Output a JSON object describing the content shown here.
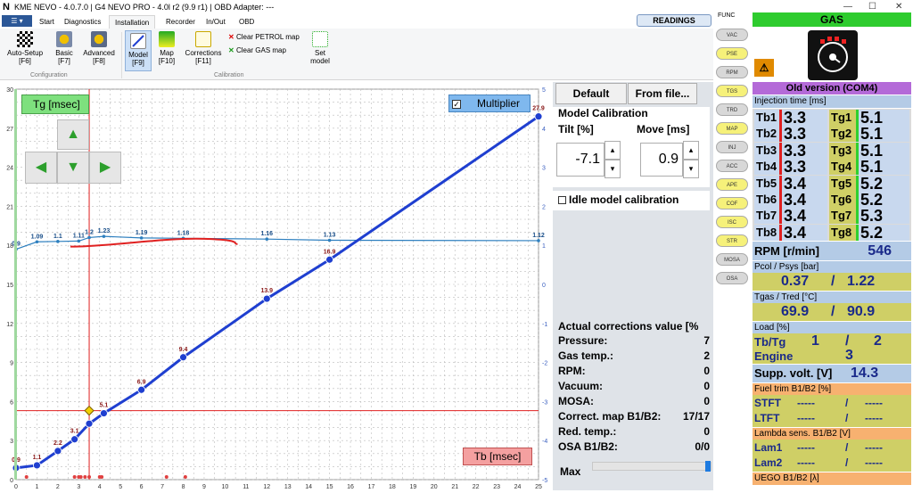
{
  "window": {
    "title": "KME NEVO - 4.0.7.0  |  G4 NEVO PRO - 4.0l r2 (9.9 r1)  |  OBD Adapter: ---",
    "logo": "N"
  },
  "menu": {
    "file": "☰ ▾",
    "tabs": [
      "Start",
      "Diagnostics",
      "Installation",
      "Recorder",
      "In/Out",
      "OBD"
    ],
    "readings": "READINGS"
  },
  "ribbon": {
    "buttons": [
      {
        "label": "Auto-Setup",
        "key": "[F6]"
      },
      {
        "label": "Basic",
        "key": "[F7]"
      },
      {
        "label": "Advanced",
        "key": "[F8]"
      },
      {
        "label": "Model",
        "key": "[F9]"
      },
      {
        "label": "Map",
        "key": "[F10]"
      },
      {
        "label": "Corrections",
        "key": "[F11]"
      }
    ],
    "clear_petrol": "Clear PETROL map",
    "clear_gas": "Clear GAS map",
    "set_model": "Set model",
    "group_config": "Configuration",
    "group_calib": "Calibration"
  },
  "chart": {
    "tg_label": "Tg [msec]",
    "tb_label": "Tb [msec]",
    "multiplier": "Multiplier",
    "left_ticks": [
      "30",
      "27",
      "24",
      "21",
      "18",
      "15",
      "12",
      "9",
      "6",
      "3",
      "0"
    ],
    "right_ticks": [
      "5",
      "4",
      "3",
      "2",
      "1",
      "0",
      "-1",
      "-2",
      "-3",
      "-4",
      "-5"
    ],
    "x_ticks": [
      "0",
      "1",
      "2",
      "3",
      "4",
      "5",
      "6",
      "7",
      "8",
      "9",
      "10",
      "11",
      "12",
      "13",
      "14",
      "15",
      "16",
      "17",
      "18",
      "19",
      "20",
      "21",
      "22",
      "23",
      "24",
      "25"
    ],
    "model_points": [
      {
        "x": 0,
        "y": 0.9,
        "label": "0.9"
      },
      {
        "x": 1,
        "y": 1.1,
        "label": "1.1"
      },
      {
        "x": 2,
        "y": 2.2,
        "label": "2.2"
      },
      {
        "x": 2.8,
        "y": 3.1,
        "label": "3.1"
      },
      {
        "x": 3.5,
        "y": 4.3,
        "label": ""
      },
      {
        "x": 4.2,
        "y": 5.1,
        "label": "5.1"
      },
      {
        "x": 6,
        "y": 6.9,
        "label": "6.9"
      },
      {
        "x": 8,
        "y": 9.4,
        "label": "9.4"
      },
      {
        "x": 12,
        "y": 13.9,
        "label": "13.9"
      },
      {
        "x": 15,
        "y": 16.9,
        "label": "16.9"
      },
      {
        "x": 25,
        "y": 27.9,
        "label": "27.9"
      }
    ],
    "multiplier_points": [
      {
        "x": 0,
        "y": 0.9,
        "label": "0.9"
      },
      {
        "x": 1,
        "y": 1.09,
        "label": "1.09"
      },
      {
        "x": 2,
        "y": 1.1,
        "label": "1.1"
      },
      {
        "x": 3,
        "y": 1.11,
        "label": "1.11"
      },
      {
        "x": 3.5,
        "y": 1.2,
        "label": "1.2"
      },
      {
        "x": 4.2,
        "y": 1.23,
        "label": "1.23"
      },
      {
        "x": 6,
        "y": 1.19,
        "label": "1.19"
      },
      {
        "x": 8,
        "y": 1.18,
        "label": "1.18"
      },
      {
        "x": 12,
        "y": 1.16,
        "label": "1.16"
      },
      {
        "x": 15,
        "y": 1.13,
        "label": "1.13"
      },
      {
        "x": 25,
        "y": 1.12,
        "label": "1.12"
      }
    ],
    "cursor": {
      "x": 3.5,
      "y": 5.3
    }
  },
  "calib": {
    "default_btn": "Default",
    "from_file_btn": "From file...",
    "title": "Model Calibration",
    "tilt_label": "Tilt [%]",
    "move_label": "Move [ms]",
    "tilt_value": "-7.1",
    "move_value": "0.9",
    "idle_label": "Idle model calibration",
    "corr_title": "Actual corrections value [%",
    "corrections": [
      {
        "k": "Pressure:",
        "v": "7"
      },
      {
        "k": "Gas temp.:",
        "v": "2"
      },
      {
        "k": "RPM:",
        "v": "0"
      },
      {
        "k": "Vacuum:",
        "v": "0"
      },
      {
        "k": "MOSA:",
        "v": "0"
      },
      {
        "k": "Correct. map B1/B2:",
        "v": "17/17"
      },
      {
        "k": "Red. temp.:",
        "v": "0"
      },
      {
        "k": "OSA B1/B2:",
        "v": "0/0"
      }
    ],
    "max_label": "Max"
  },
  "func": {
    "title": "FUNC",
    "items": [
      "VAC",
      "PSE",
      "RPM",
      "TGS",
      "TRD",
      "MAP",
      "INJ",
      "ACC",
      "APE",
      "COF",
      "ISC",
      "STR",
      "MOSA",
      "OSA"
    ]
  },
  "gas": {
    "title": "GAS",
    "version": "Old version (COM4)",
    "inj_title": "Injection time [ms]",
    "tb": [
      {
        "k": "Tb1",
        "v": "3.3"
      },
      {
        "k": "Tb2",
        "v": "3.3"
      },
      {
        "k": "Tb3",
        "v": "3.3"
      },
      {
        "k": "Tb4",
        "v": "3.3"
      },
      {
        "k": "Tb5",
        "v": "3.4"
      },
      {
        "k": "Tb6",
        "v": "3.4"
      },
      {
        "k": "Tb7",
        "v": "3.4"
      },
      {
        "k": "Tb8",
        "v": "3.4"
      }
    ],
    "tg": [
      {
        "k": "Tg1",
        "v": "5.1"
      },
      {
        "k": "Tg2",
        "v": "5.1"
      },
      {
        "k": "Tg3",
        "v": "5.1"
      },
      {
        "k": "Tg4",
        "v": "5.1"
      },
      {
        "k": "Tg5",
        "v": "5.2"
      },
      {
        "k": "Tg6",
        "v": "5.2"
      },
      {
        "k": "Tg7",
        "v": "5.3"
      },
      {
        "k": "Tg8",
        "v": "5.2"
      }
    ],
    "rpm_label": "RPM [r/min]",
    "rpm": "546",
    "pcol_label": "Pcol / Psys [bar]",
    "pcol": "0.37",
    "psys": "1.22",
    "tgas_label": "Tgas / Tred [°C]",
    "tgas": "69.9",
    "tred": "90.9",
    "load_label": "Load [%]",
    "tbtg_label": "Tb/Tg",
    "load1": "1",
    "load2": "2",
    "engine_label": "Engine",
    "engine": "3",
    "supp_label": "Supp. volt. [V]",
    "supp": "14.3",
    "ft_label": "Fuel trim B1/B2 [%]",
    "stft": "STFT",
    "ltft": "LTFT",
    "dash": "-----",
    "lambda_label": "Lambda sens. B1/B2 [V]",
    "lam1": "Lam1",
    "lam2": "Lam2",
    "uego_label": "UEGO B1/B2 [λ]",
    "slash": "/"
  },
  "colors": {
    "model": "#1f3fd0",
    "mult": "#2d7fbf",
    "red": "#e02020",
    "gasgreen": "#2fd02f",
    "gasyellow": "#cfcf66"
  }
}
